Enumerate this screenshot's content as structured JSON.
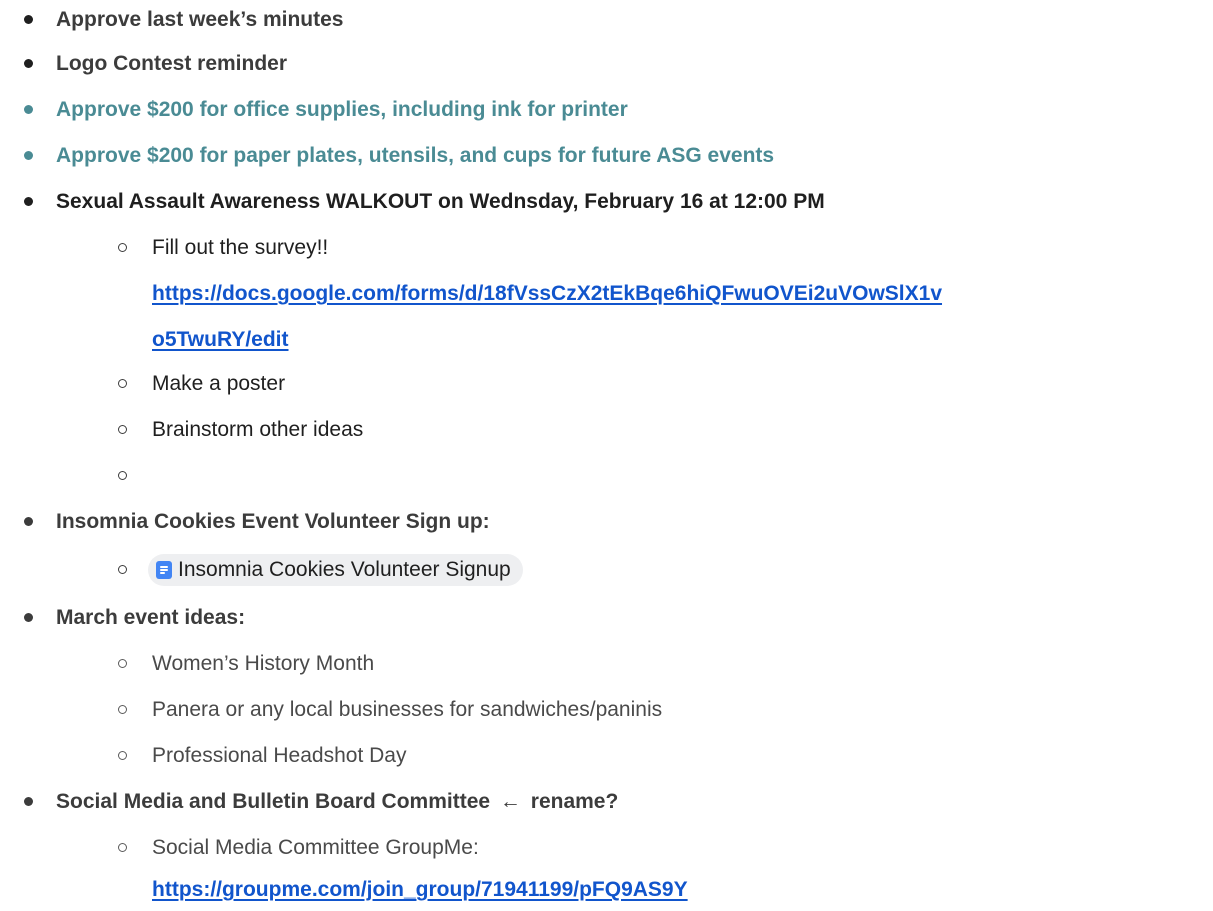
{
  "items": {
    "approve_minutes": "Approve last week’s minutes",
    "logo_contest": "Logo Contest reminder",
    "approve_office": "Approve $200 for office supplies, including ink for printer",
    "approve_plates": "Approve $200 for paper plates, utensils, and cups for future ASG events",
    "walkout": "Sexual Assault Awareness WALKOUT on Wednsday, February 16 at 12:00 PM",
    "walkout_sub": {
      "survey": "Fill out the survey!!",
      "survey_link_line1": "https://docs.google.com/forms/d/18fVssCzX2tEkBqe6hiQFwuOVEi2uVOwSlX1v",
      "survey_link_line2": "o5TwuRY/edit",
      "poster": "Make a poster",
      "brainstorm": "Brainstorm other ideas"
    },
    "insomnia": "Insomnia Cookies Event Volunteer Sign up:",
    "insomnia_chip": "Insomnia Cookies Volunteer Signup",
    "march": "March event ideas:",
    "march_sub": {
      "womens": "Women’s History Month",
      "panera": "Panera or any local businesses for sandwiches/paninis",
      "headshot": "Professional Headshot Day"
    },
    "social_title": "Social Media and Bulletin Board Committee",
    "social_arrow": "←",
    "social_rename": "rename?",
    "social_sub": {
      "groupme": "Social Media Committee GroupMe:",
      "groupme_link": "https://groupme.com/join_group/71941199/pFQ9AS9Y"
    }
  },
  "colors": {
    "teal": "#4a8b94",
    "link": "#1155cc",
    "text": "#1f1f1f",
    "chip_bg": "#eeeff1",
    "doc_icon": "#4285f4"
  },
  "icons": {
    "chip_icon": "google-docs-icon"
  }
}
